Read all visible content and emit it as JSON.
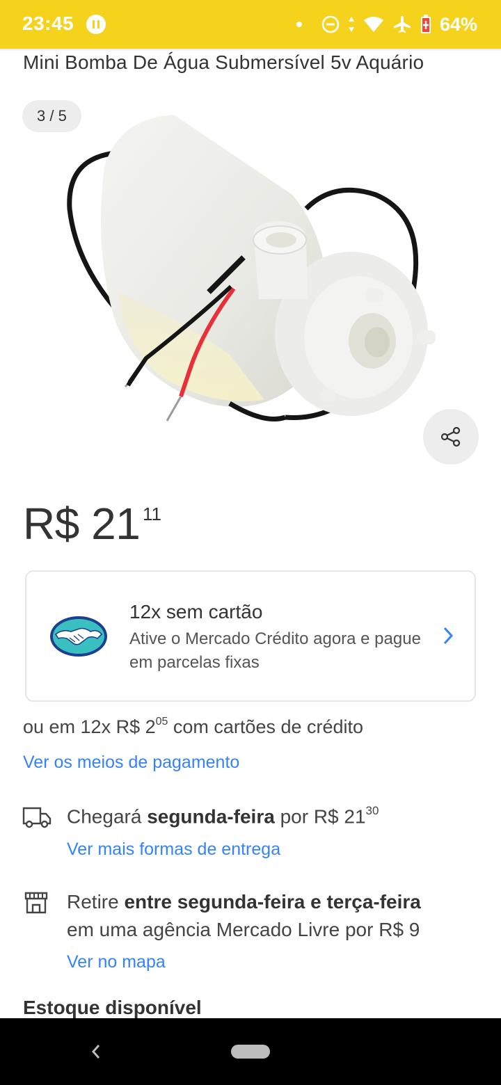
{
  "status_bar": {
    "time": "23:45",
    "battery": "64%"
  },
  "product": {
    "title": "Mini Bomba De Água Submersível 5v Aquário",
    "image_counter": "3 / 5",
    "price_main": "R$ 21",
    "price_cents": "11"
  },
  "credit": {
    "title": "12x sem cartão",
    "subtitle": "Ative o Mercado Crédito agora e pague em parcelas fixas"
  },
  "payment": {
    "installments_prefix": "ou em 12x R$ 2",
    "installments_cents": "05",
    "installments_suffix": " com cartões de crédito",
    "link": "Ver os meios de pagamento"
  },
  "shipping": {
    "prefix": "Chegará ",
    "day": "segunda-feira",
    "middle": " por R$ 21",
    "cents": "30",
    "link": "Ver mais formas de entrega"
  },
  "pickup": {
    "prefix": "Retire ",
    "window": "entre segunda-feira e terça-feira",
    "line2": "em uma agência Mercado Livre por R$ 9",
    "link": "Ver no mapa"
  },
  "stock": {
    "label": "Estoque disponível"
  },
  "colors": {
    "status_bar": "#f5d21c",
    "link": "#3483fa",
    "text": "#333333"
  },
  "icons": [
    "pause-icon",
    "dnd-icon",
    "wifi-icon",
    "airplane-icon",
    "battery-icon",
    "share-icon",
    "mercado-pago-icon",
    "chevron-right-icon",
    "truck-icon",
    "store-icon",
    "back-icon"
  ]
}
